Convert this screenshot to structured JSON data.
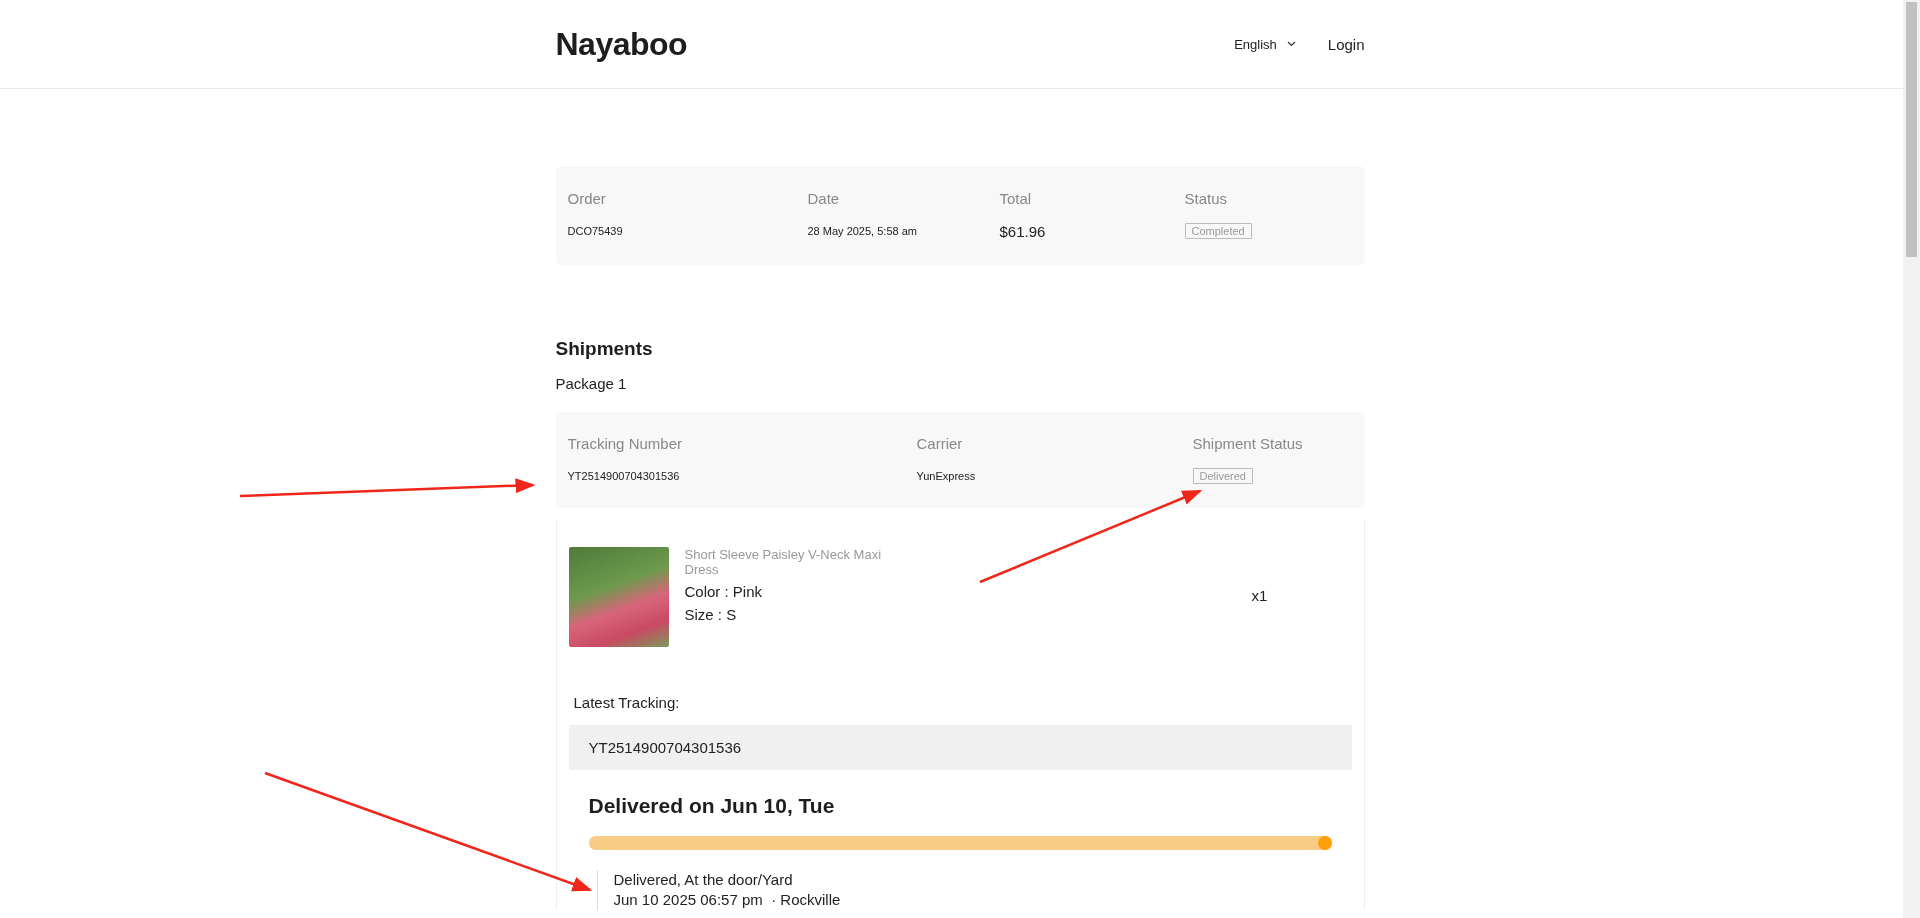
{
  "header": {
    "logo": "Nayaboo",
    "language": "English",
    "login": "Login"
  },
  "order": {
    "columns": [
      "Order",
      "Date",
      "Total",
      "Status"
    ],
    "number": "DCO75439",
    "date": "28 May 2025, 5:58 am",
    "total": "$61.96",
    "status": "Completed"
  },
  "shipments": {
    "title": "Shipments",
    "package": "Package 1",
    "columns": [
      "Tracking Number",
      "Carrier",
      "Shipment Status"
    ],
    "tracking_number": "YT2514900704301536",
    "carrier": "YunExpress",
    "status": "Delivered",
    "item": {
      "name": "Short Sleeve Paisley V-Neck Maxi Dress",
      "color_text": "Color : Pink",
      "size": "Size : S",
      "quantity": "x1"
    },
    "latest_tracking": {
      "label": "Latest Tracking:",
      "number": "YT2514900704301536",
      "headline": "Delivered on Jun 10, Tue",
      "level": 1,
      "events": [
        {
          "title": "Delivered, At the door/Yard",
          "time": "Jun 10 2025 06:57 pm",
          "place": "· Rockville"
        }
      ]
    }
  }
}
